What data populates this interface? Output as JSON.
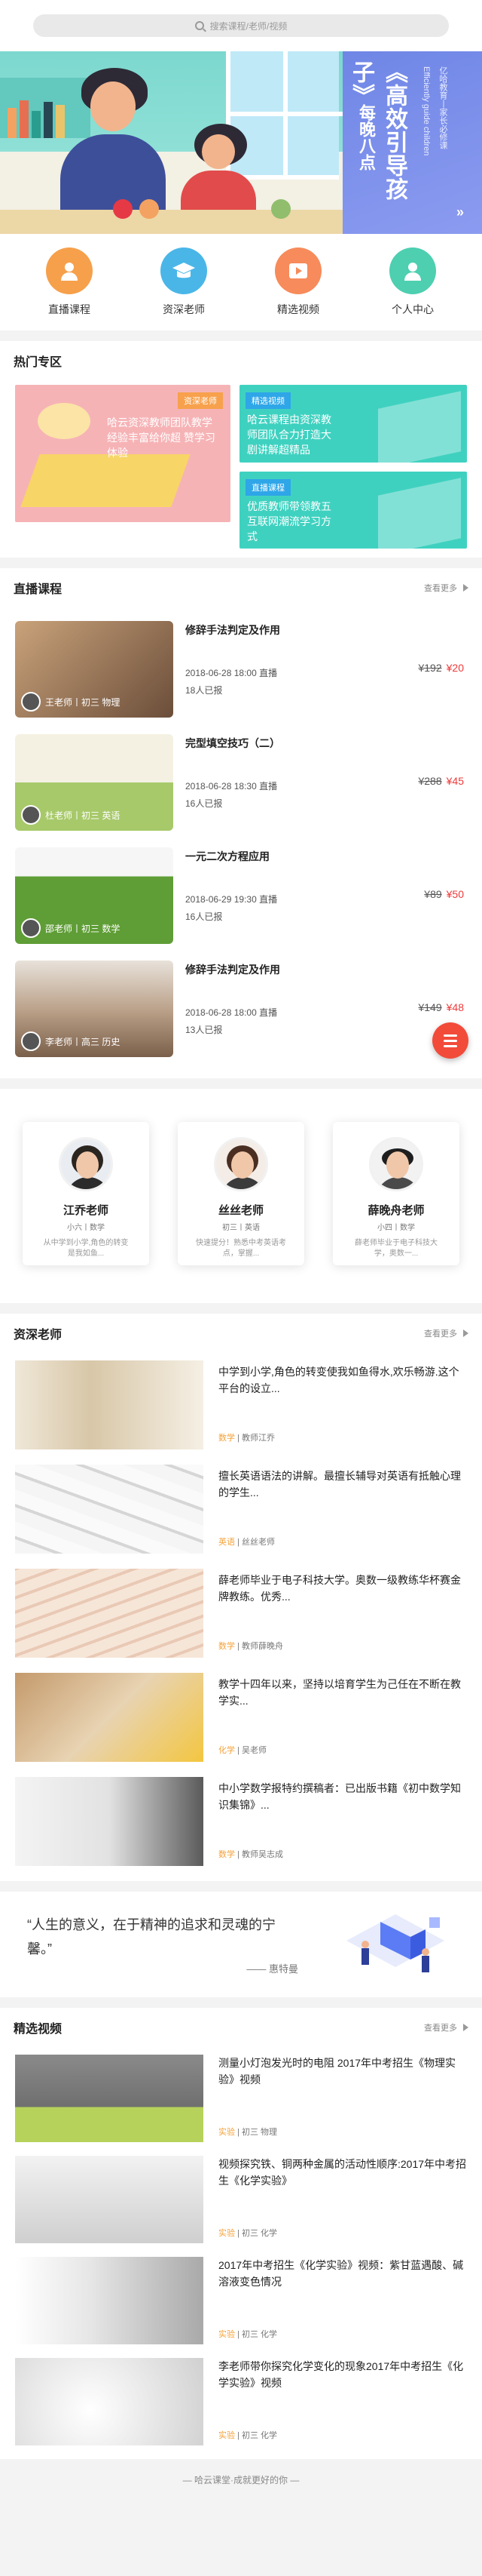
{
  "search": {
    "placeholder": "搜索课程/老师/视频",
    "icon": "search-icon"
  },
  "banner": {
    "title": "《高效引导孩子》",
    "time": "每晚八点",
    "sub_en": "Efficiently guide children",
    "sub_cn": "亿哈教育丨家长必修课",
    "arrow_icon": "double-chevron-right-icon"
  },
  "quick_nav": [
    {
      "label": "直播课程",
      "icon": "live-person-icon",
      "color": "#f6a04b"
    },
    {
      "label": "资深老师",
      "icon": "graduation-cap-icon",
      "color": "#4ab6e8"
    },
    {
      "label": "精选视频",
      "icon": "play-icon",
      "color": "#f78b5b"
    },
    {
      "label": "个人中心",
      "icon": "user-icon",
      "color": "#4dcfb0"
    }
  ],
  "hot": {
    "title": "热门专区",
    "big": {
      "tag": "资深老师",
      "text": "哈云资深教师团队教学 经验丰富给你超 赞学习体验"
    },
    "cards": [
      {
        "tag": "精选视频",
        "text": "哈云课程由资深教师团队合力打造大剧讲解超精品",
        "color": "#3fd1c0"
      },
      {
        "tag": "直播课程",
        "text": "优质教师带领教五互联网潮流学习方式",
        "color": "#3fd1c0"
      }
    ]
  },
  "live": {
    "title": "直播课程",
    "more": "查看更多",
    "courses": [
      {
        "title": "修辞手法判定及作用",
        "time": "2018-06-28 18:00 直播",
        "enroll": "18人已报",
        "old_price": "¥192",
        "new_price": "¥20",
        "teacher": "王老师丨初三 物理",
        "bg": "#8e6c52"
      },
      {
        "title": "完型填空技巧（二）",
        "time": "2018-06-28 18:30 直播",
        "enroll": "16人已报",
        "old_price": "¥288",
        "new_price": "¥45",
        "teacher": "杜老师丨初三 英语",
        "bg": "#a7c96a"
      },
      {
        "title": "一元二次方程应用",
        "time": "2018-06-29 19:30 直播",
        "enroll": "16人已报",
        "old_price": "¥89",
        "new_price": "¥50",
        "teacher": "邵老师丨初三 数学",
        "bg": "#6da33e"
      },
      {
        "title": "修辞手法判定及作用",
        "time": "2018-06-28 18:00 直播",
        "enroll": "13人已报",
        "old_price": "¥149",
        "new_price": "¥48",
        "teacher": "李老师丨高三 历史",
        "bg": "#b79c84"
      }
    ],
    "fab_icon": "menu-icon"
  },
  "featured_teachers": [
    {
      "name": "江乔老师",
      "meta": "小六丨数学",
      "desc": "从中学到小学,角色的转变是我如鱼...",
      "shirt": "#2b2b2b"
    },
    {
      "name": "丝丝老师",
      "meta": "初三丨英语",
      "desc": "快速提分！熟悉中考英语考点，掌握...",
      "shirt": "#3b3b3b"
    },
    {
      "name": "薛晚舟老师",
      "meta": "小四丨数学",
      "desc": "薛老师毕业于电子科技大学，奥数一...",
      "shirt": "#4a4a4a"
    }
  ],
  "senior": {
    "title": "资深老师",
    "more": "查看更多",
    "items": [
      {
        "desc": "中学到小学,角色的转变使我如鱼得水,欢乐畅游.这个平台的设立...",
        "subject": "数学",
        "teacher": "教师江乔",
        "bg": "#e6dccb"
      },
      {
        "desc": "擅长英语语法的讲解。最擅长辅导对英语有抵触心理的学生...",
        "subject": "英语",
        "teacher": "丝丝老师",
        "bg": "#e9e9e9"
      },
      {
        "desc": "薛老师毕业于电子科技大学。奥数一级教练华杯赛金牌教练。优秀...",
        "subject": "数学",
        "teacher": "教师薛晚舟",
        "bg": "#f3e3d6"
      },
      {
        "desc": "教学十四年以来，坚持以培育学生为己任在不断在教学实...",
        "subject": "化学",
        "teacher": "吴老师",
        "bg": "#d9c3a2"
      },
      {
        "desc": "中小学数学报特约撰稿者：已出版书籍《初中数学知识集锦》...",
        "subject": "数学",
        "teacher": "教师吴志成",
        "bg": "#e0e0e0"
      }
    ]
  },
  "quote": {
    "text": "“人生的意义，在于精神的追求和灵魂的宁馨。”",
    "author": "—— 惠特曼"
  },
  "videos": {
    "title": "精选视频",
    "more": "查看更多",
    "items": [
      {
        "title": "测量小灯泡发光时的电阻 2017年中考招生《物理实验》视频",
        "subject": "实验",
        "grade": "初三 物理",
        "bg": "#7a7a7a"
      },
      {
        "title": "视频探究铁、铜两种金属的活动性顺序:2017年中考招生《化学实验》",
        "subject": "实验",
        "grade": "初三 化学",
        "bg": "#cfcfcf"
      },
      {
        "title": "2017年中考招生《化学实验》视频：紫甘蓝遇酸、碱溶液变色情况",
        "subject": "实验",
        "grade": "初三 化学",
        "bg": "#c8c8c8"
      },
      {
        "title": "李老师带你探究化学变化的现象2017年中考招生《化学实验》视频",
        "subject": "实验",
        "grade": "初三 化学",
        "bg": "#e8e8e8"
      }
    ]
  },
  "footer": "— 哈云课堂·成就更好的你 —"
}
